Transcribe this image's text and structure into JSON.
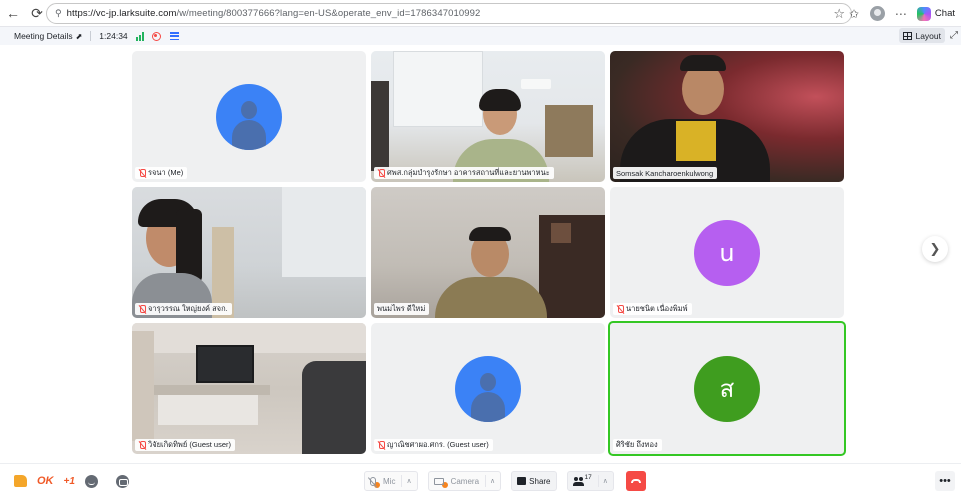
{
  "browser": {
    "url_host": "https://vc-jp.larksuite.com",
    "url_path": "/w/meeting/800377666?lang=en-US&operate_env_id=1786347010992",
    "chat_label": "Chat"
  },
  "meeting": {
    "details_label": "Meeting Details",
    "elapsed": "1:24:34",
    "layout_label": "Layout"
  },
  "participants": [
    {
      "name": "รจนา (Me)",
      "muted": true,
      "type": "avatar-person"
    },
    {
      "name": "ศพส.กลุ่มบำรุงรักษา อาคารสถานที่และยานพาหนะ",
      "muted": true,
      "type": "video"
    },
    {
      "name": "Somsak Kancharoenkulwong",
      "muted": false,
      "type": "video"
    },
    {
      "name": "จารุวรรณ ใหญ่ยงค์ สจก.",
      "muted": true,
      "type": "video"
    },
    {
      "name": "พนมไพร ดีใหม่",
      "muted": false,
      "type": "video"
    },
    {
      "name": "นายชนิต เนื่องพิมพ์",
      "muted": true,
      "type": "avatar-letter",
      "letter": "u",
      "color": "#b65ff0"
    },
    {
      "name": "วิจัยเกิดทิพย์ (Guest user)",
      "muted": true,
      "type": "video"
    },
    {
      "name": "ญาณิชศาผอ.ศกร. (Guest user)",
      "muted": true,
      "type": "avatar-person"
    },
    {
      "name": "ศิริชัย ถึงทอง",
      "muted": false,
      "type": "avatar-letter",
      "letter": "ส",
      "color": "#3f9d1f",
      "active": true
    }
  ],
  "toolbar": {
    "reaction_ok": "OK",
    "reaction_plus": "+1",
    "mic_label": "Mic",
    "camera_label": "Camera",
    "share_label": "Share",
    "participant_count": "17"
  }
}
